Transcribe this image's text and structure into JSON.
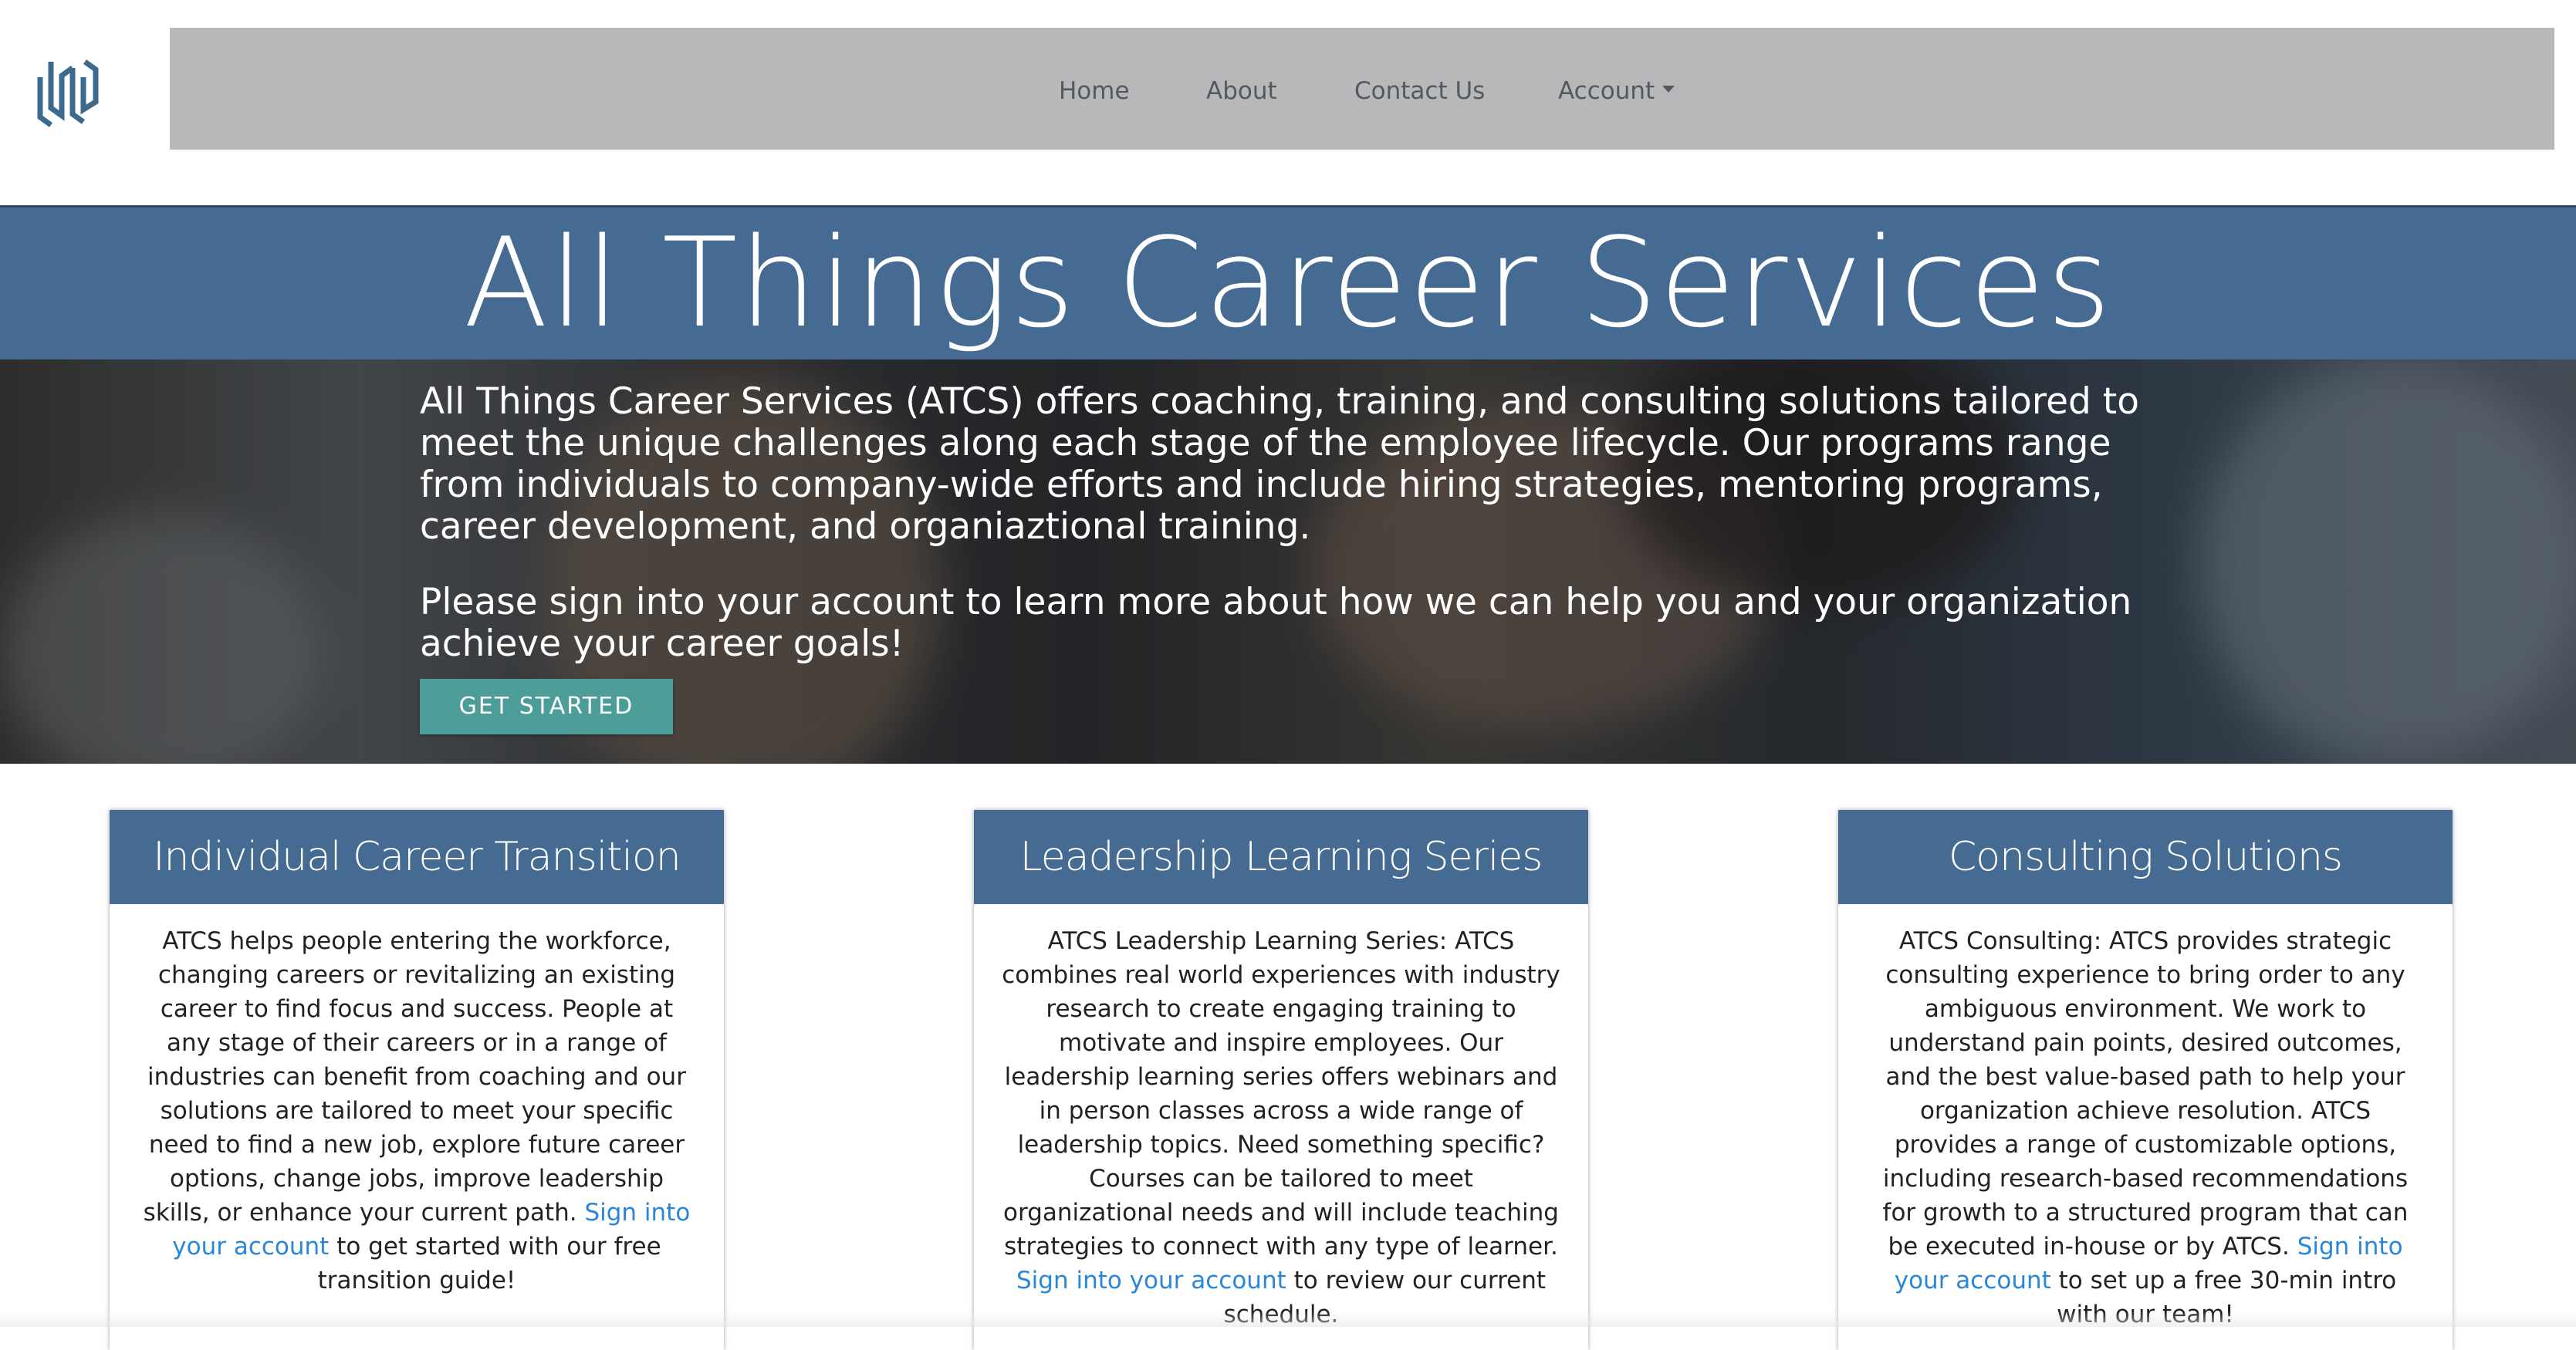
{
  "brand": {
    "logo_icon": "geometric-hex-logo-icon",
    "logo_color": "#3c6a8e"
  },
  "nav": {
    "items": [
      {
        "label": "Home"
      },
      {
        "label": "About"
      },
      {
        "label": "Contact Us"
      },
      {
        "label": "Account"
      }
    ],
    "account_caret_icon": "caret-down-icon"
  },
  "hero": {
    "title": "All Things Career Services",
    "paragraph1": "All Things Career Services (ATCS) offers coaching, training, and consulting solutions tailored to meet the unique challenges along each stage of the employee lifecycle. Our programs range from individuals to company-wide efforts and include hiring strategies, mentoring programs, career development, and organiaztional training.",
    "paragraph2": "Please sign into your account to learn more about how we can help you and your organization achieve your career goals!",
    "cta_label": "GET STARTED"
  },
  "cards": [
    {
      "title": "Individual Career Transition",
      "body_before": "ATCS helps people entering the workforce, changing careers or revitalizing an existing career to find focus and success. People at any stage of their careers or in a range of industries can benefit from coaching and our solutions are tailored to meet your specific need to find a new job, explore future career options, change jobs, improve leadership skills, or enhance your current path.",
      "link": "Sign into your account",
      "body_after": "to get started with our free transition guide!"
    },
    {
      "title": "Leadership Learning Series",
      "body_before": "ATCS Leadership Learning Series: ATCS combines real world experiences with industry research to create engaging training to motivate and inspire employees. Our leadership learning series offers webinars and in person classes across a wide range of leadership topics. Need something specific? Courses can be tailored to meet organizational needs and will include teaching strategies to connect with any type of learner.",
      "link": "Sign into your account",
      "body_after": "to review our current schedule."
    },
    {
      "title": "Consulting Solutions",
      "body_before": "ATCS Consulting: ATCS provides strategic consulting experience to bring order to any ambiguous environment. We work to understand pain points, desired outcomes, and the best value-based path to help your organization achieve resolution. ATCS provides a range of customizable options, including research-based recommendations for growth to a structured program that can be executed in-house or by ATCS.",
      "link": "Sign into your account",
      "body_after": "to set up a free 30-min intro with our team!"
    }
  ],
  "colors": {
    "primary_blue": "#466b93",
    "nav_gray": "#b7b8ba",
    "cta_teal": "#4c9d97",
    "link_blue": "#2a86d8"
  }
}
